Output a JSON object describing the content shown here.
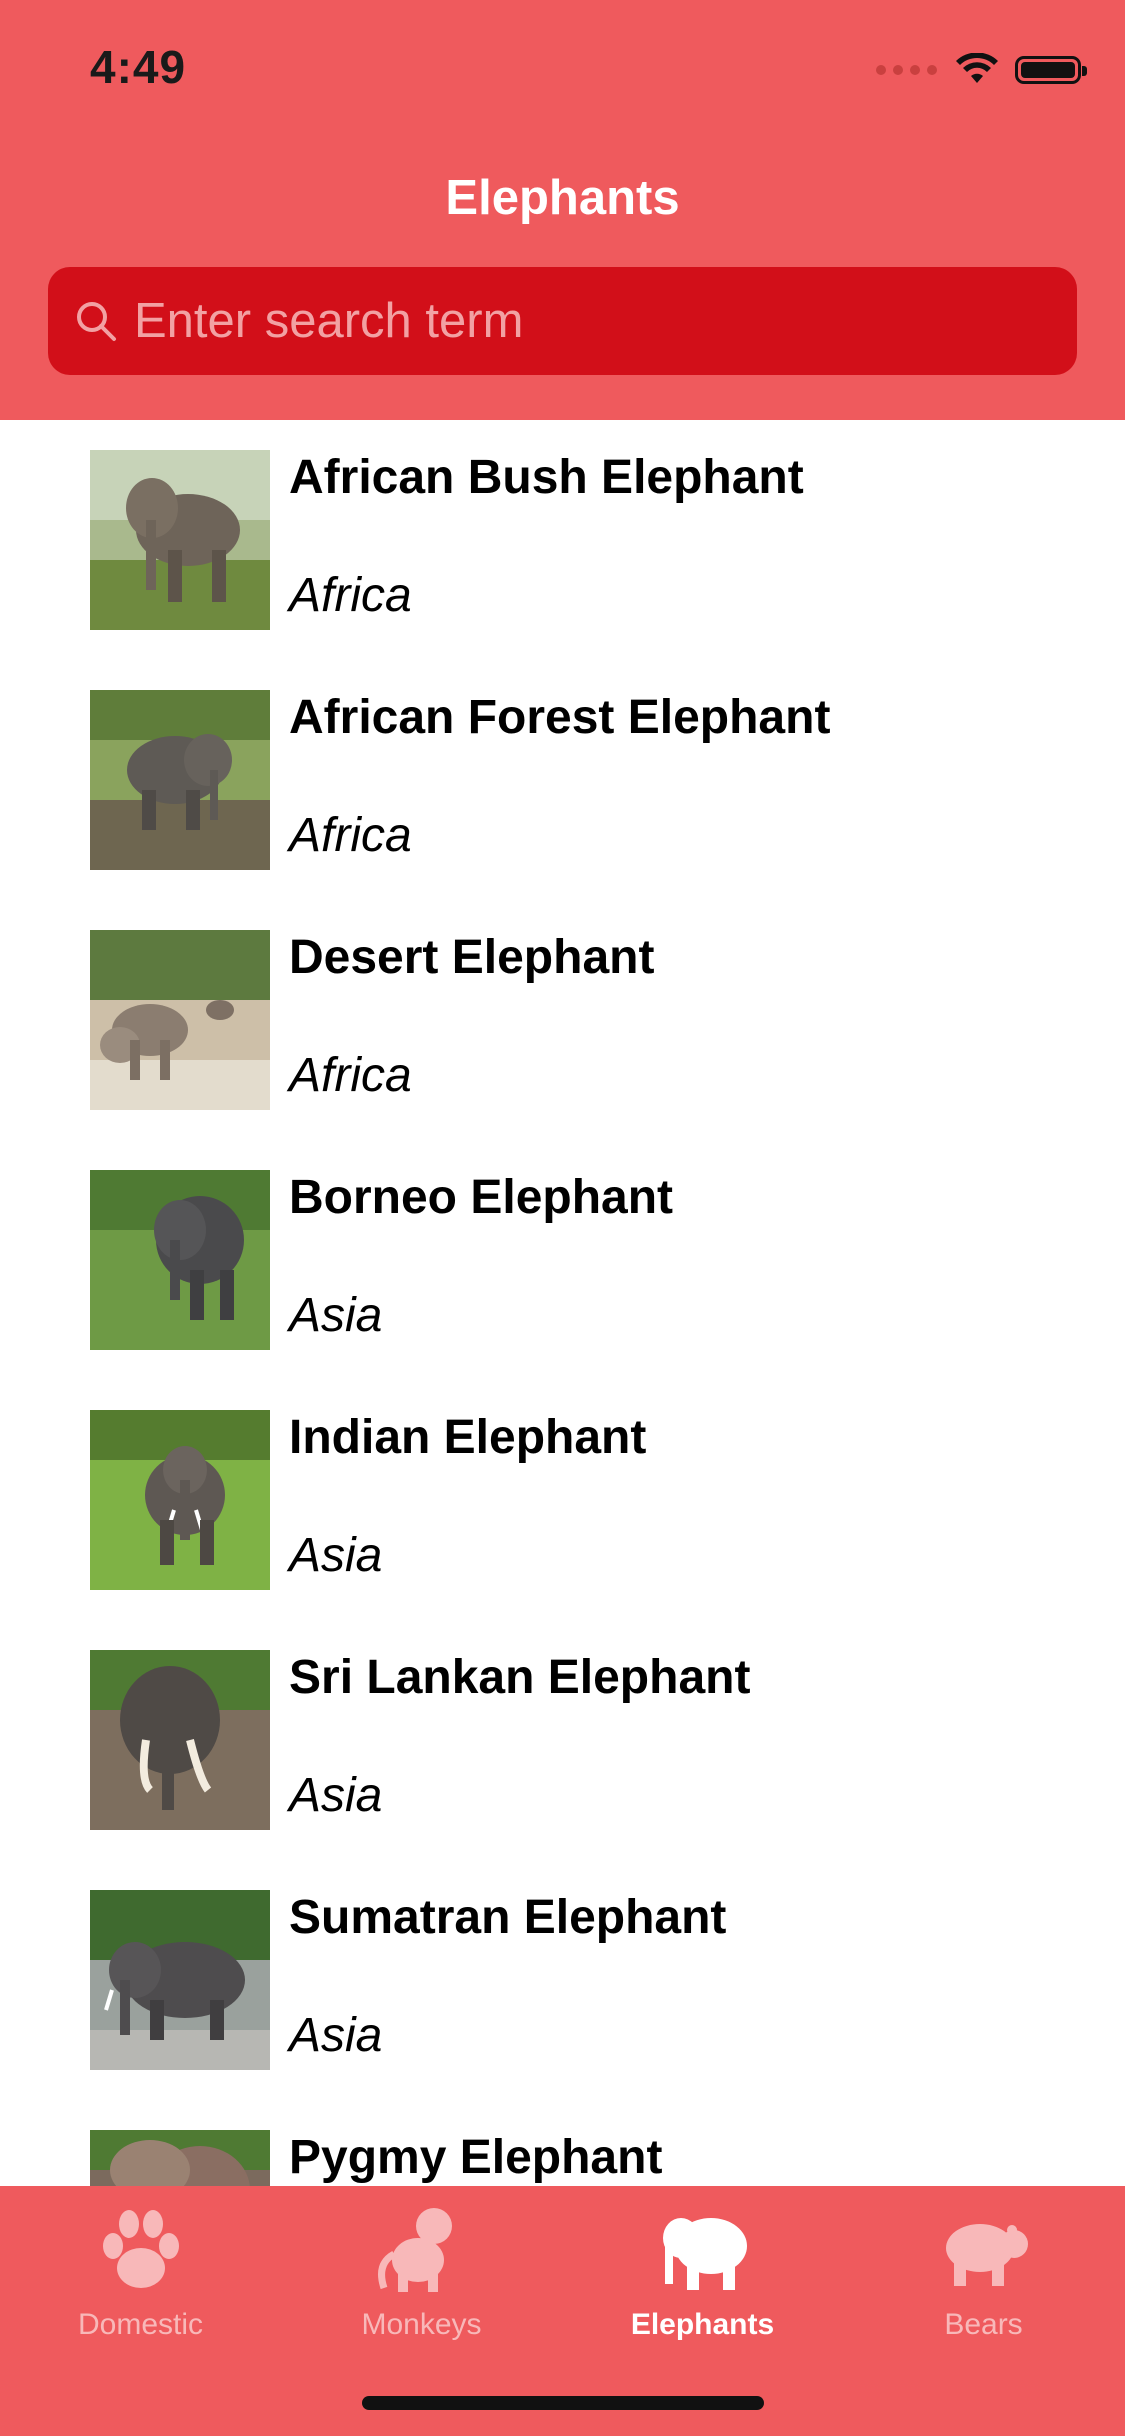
{
  "status": {
    "time": "4:49"
  },
  "nav": {
    "title": "Elephants"
  },
  "search": {
    "placeholder": "Enter search term",
    "value": ""
  },
  "items": [
    {
      "name": "African Bush Elephant",
      "region": "Africa"
    },
    {
      "name": "African Forest Elephant",
      "region": "Africa"
    },
    {
      "name": "Desert Elephant",
      "region": "Africa"
    },
    {
      "name": "Borneo Elephant",
      "region": "Asia"
    },
    {
      "name": "Indian Elephant",
      "region": "Asia"
    },
    {
      "name": "Sri Lankan Elephant",
      "region": "Asia"
    },
    {
      "name": "Sumatran Elephant",
      "region": "Asia"
    },
    {
      "name": "Pygmy Elephant",
      "region": ""
    }
  ],
  "tabs": [
    {
      "label": "Domestic",
      "icon": "paw-icon",
      "active": false
    },
    {
      "label": "Monkeys",
      "icon": "monkey-icon",
      "active": false
    },
    {
      "label": "Elephants",
      "icon": "elephant-icon",
      "active": true
    },
    {
      "label": "Bears",
      "icon": "bear-icon",
      "active": false
    }
  ],
  "colors": {
    "header": "#ef5a5d",
    "search_field": "#d20f19",
    "tab_active": "#ffffff",
    "tab_inactive": "#f8b8b9"
  }
}
